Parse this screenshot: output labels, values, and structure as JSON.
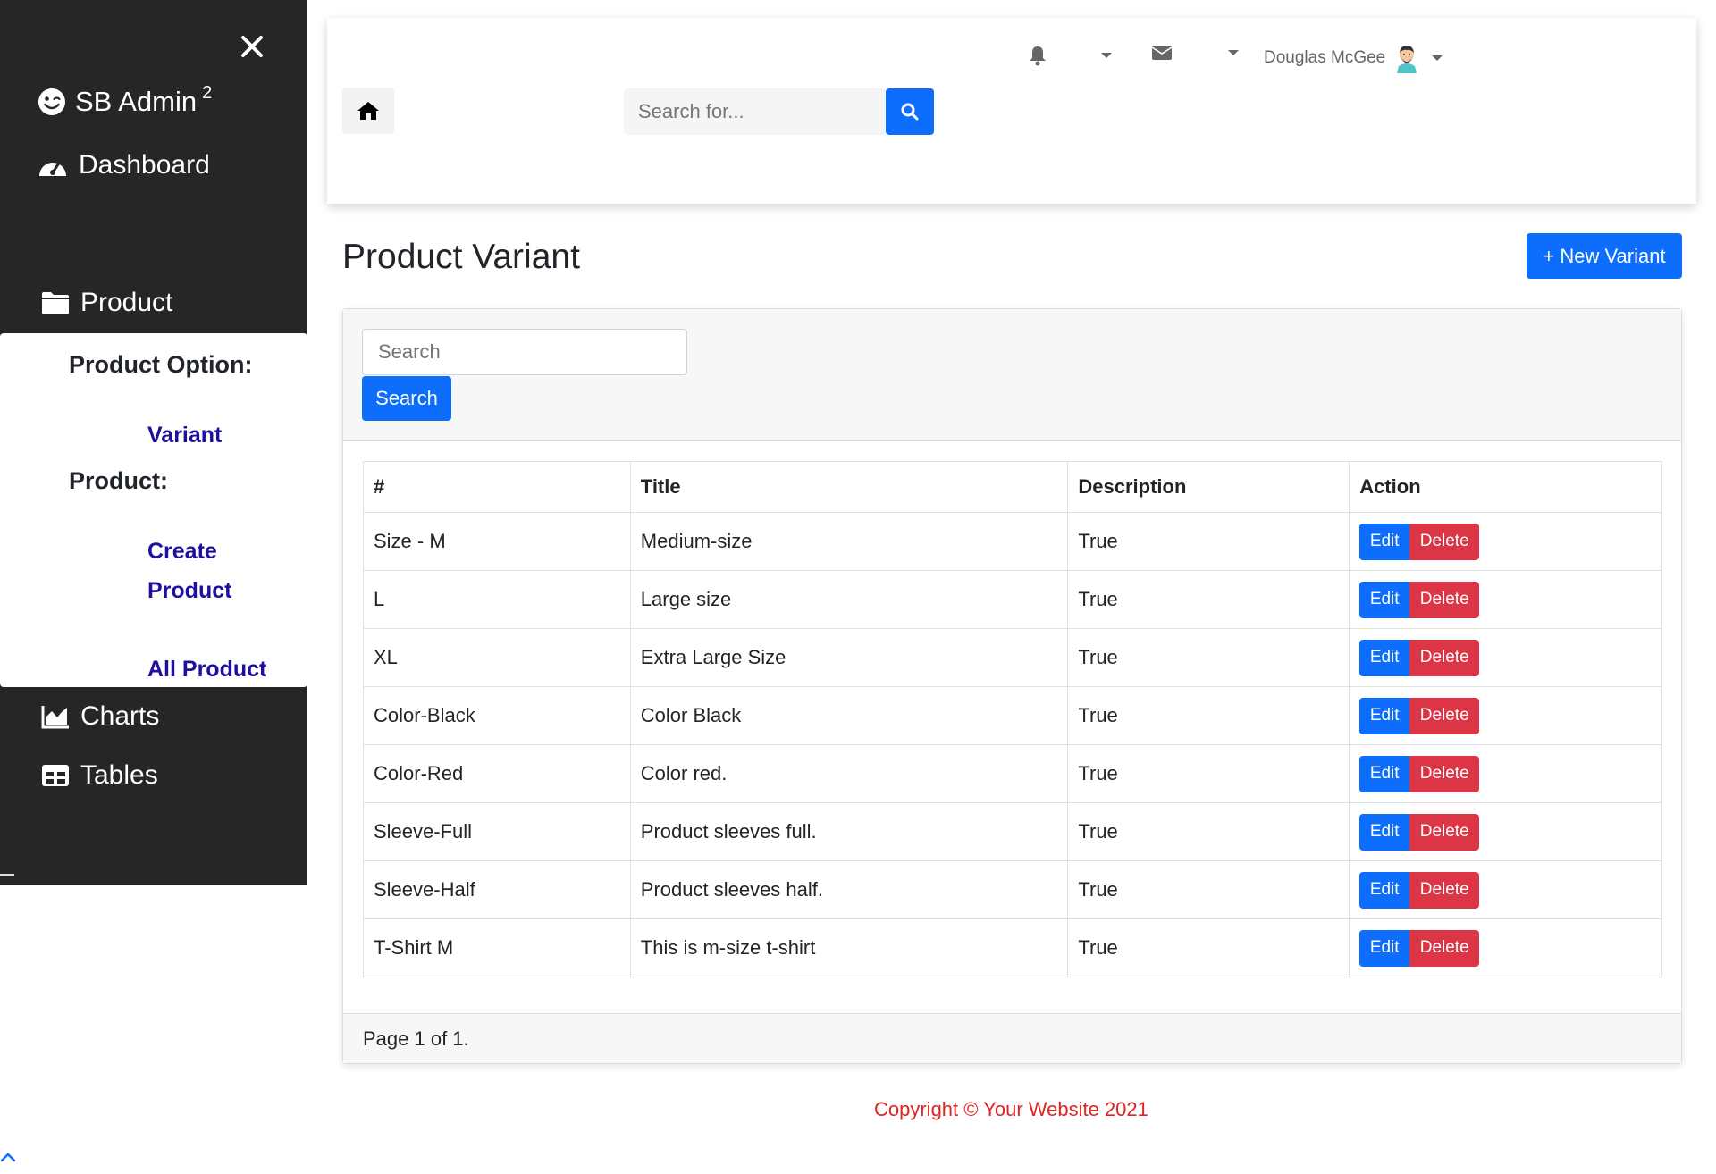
{
  "sidebar": {
    "brand": "SB Admin",
    "brand_sup": "2",
    "dashboard": "Dashboard",
    "product": "Product",
    "submenu": {
      "header_option": "Product Option:",
      "variant": "Variant",
      "header_product": "Product:",
      "create_line1": "Create",
      "create_line2": "Product",
      "all_product": "All Product"
    },
    "charts": "Charts",
    "tables": "Tables"
  },
  "topbar": {
    "search_placeholder": "Search for...",
    "user_name": "Douglas McGee"
  },
  "page": {
    "title": "Product Variant",
    "new_button": "+ New Variant"
  },
  "card": {
    "search_placeholder": "Search",
    "search_button": "Search",
    "footer": "Page 1 of 1."
  },
  "table": {
    "headers": [
      "#",
      "Title",
      "Description",
      "Action"
    ],
    "edit_label": "Edit",
    "delete_label": "Delete",
    "rows": [
      {
        "name": "Size - M",
        "title": "Medium-size",
        "description": "True"
      },
      {
        "name": "L",
        "title": "Large size",
        "description": "True"
      },
      {
        "name": "XL",
        "title": "Extra Large Size",
        "description": "True"
      },
      {
        "name": "Color-Black",
        "title": "Color Black",
        "description": "True"
      },
      {
        "name": "Color-Red",
        "title": "Color red.",
        "description": "True"
      },
      {
        "name": "Sleeve-Full",
        "title": "Product sleeves full.",
        "description": "True"
      },
      {
        "name": "Sleeve-Half",
        "title": "Product sleeves half.",
        "description": "True"
      },
      {
        "name": "T-Shirt M",
        "title": "This is m-size t-shirt",
        "description": "True"
      }
    ]
  },
  "footer": {
    "copyright": "Copyright © Your Website 2021"
  },
  "colors": {
    "sidebar_bg": "#262626",
    "primary": "#0d6efd",
    "danger": "#dc3545",
    "submenu_link": "#1e0f9e",
    "copyright": "#e02424"
  }
}
